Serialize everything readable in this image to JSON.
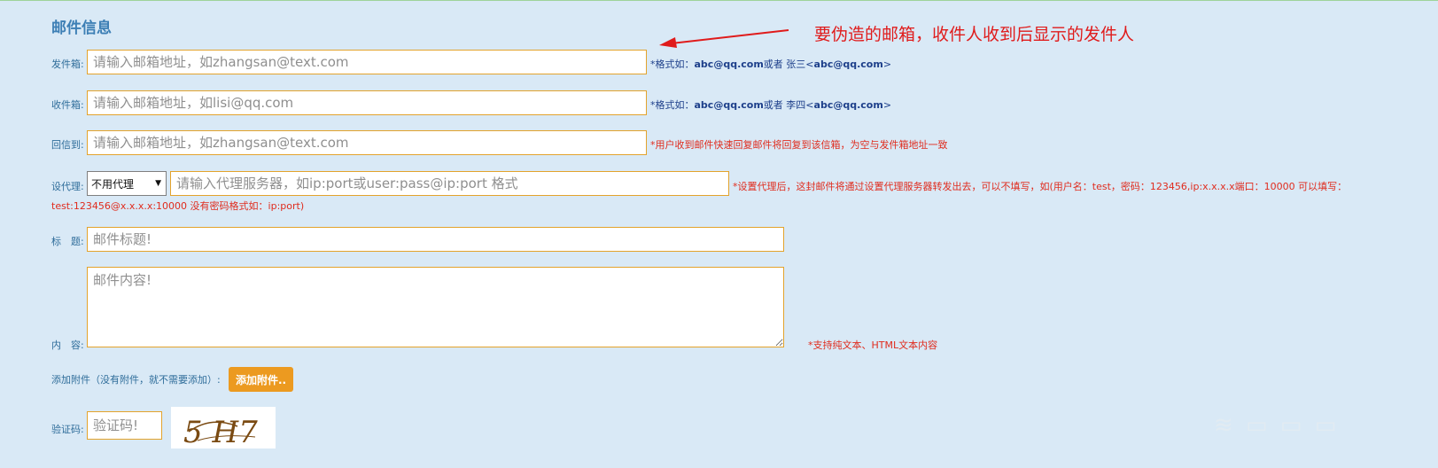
{
  "section_title": "邮件信息",
  "annotation": "要伪造的邮箱，收件人收到后显示的发件人",
  "sender": {
    "label": "发件箱:",
    "placeholder": "请输入邮箱地址，如zhangsan@text.com",
    "hint_prefix": "*格式如：",
    "hint_bold1": "abc@qq.com",
    "hint_mid": "或者 张三<",
    "hint_bold2": "abc@qq.com",
    "hint_suffix": ">"
  },
  "recipient": {
    "label": "收件箱:",
    "placeholder": "请输入邮箱地址，如lisi@qq.com",
    "hint_prefix": "*格式如：",
    "hint_bold1": "abc@qq.com",
    "hint_mid": "或者 李四<",
    "hint_bold2": "abc@qq.com",
    "hint_suffix": ">"
  },
  "reply_to": {
    "label": "回信到:",
    "placeholder": "请输入邮箱地址，如zhangsan@text.com",
    "hint": "*用户收到邮件快速回复邮件将回复到该信箱，为空与发件箱地址一致"
  },
  "proxy": {
    "label": "设代理:",
    "select_value": "不用代理",
    "placeholder": "请输入代理服务器，如ip:port或user:pass@ip:port 格式",
    "hint_line1": "*设置代理后，这封邮件将通过设置代理服务器转发出去，可以不填写，如(用户名：test，密码：123456,ip:x.x.x.x端口：10000 可以填写：",
    "hint_line2": "test:123456@x.x.x.x:10000 没有密码格式如：ip:port)"
  },
  "subject": {
    "label": "标　题:",
    "placeholder": "邮件标题!"
  },
  "content": {
    "label": "内　容:",
    "placeholder": "邮件内容!",
    "hint": "*支持纯文本、HTML文本内容"
  },
  "attachment": {
    "label": "添加附件（没有附件，就不需要添加）:",
    "button_label": "添加附件.."
  },
  "captcha": {
    "label": "验证码:",
    "placeholder": "验证码!",
    "image_text": "5 H7"
  },
  "colors": {
    "background": "#d9e9f6",
    "input_border": "#e3a32c",
    "label": "#2f6d9a",
    "hint_blue": "#1d3f8a",
    "hint_red": "#e02c1e",
    "button": "#ec9a20",
    "annotation": "#e01b1b"
  }
}
